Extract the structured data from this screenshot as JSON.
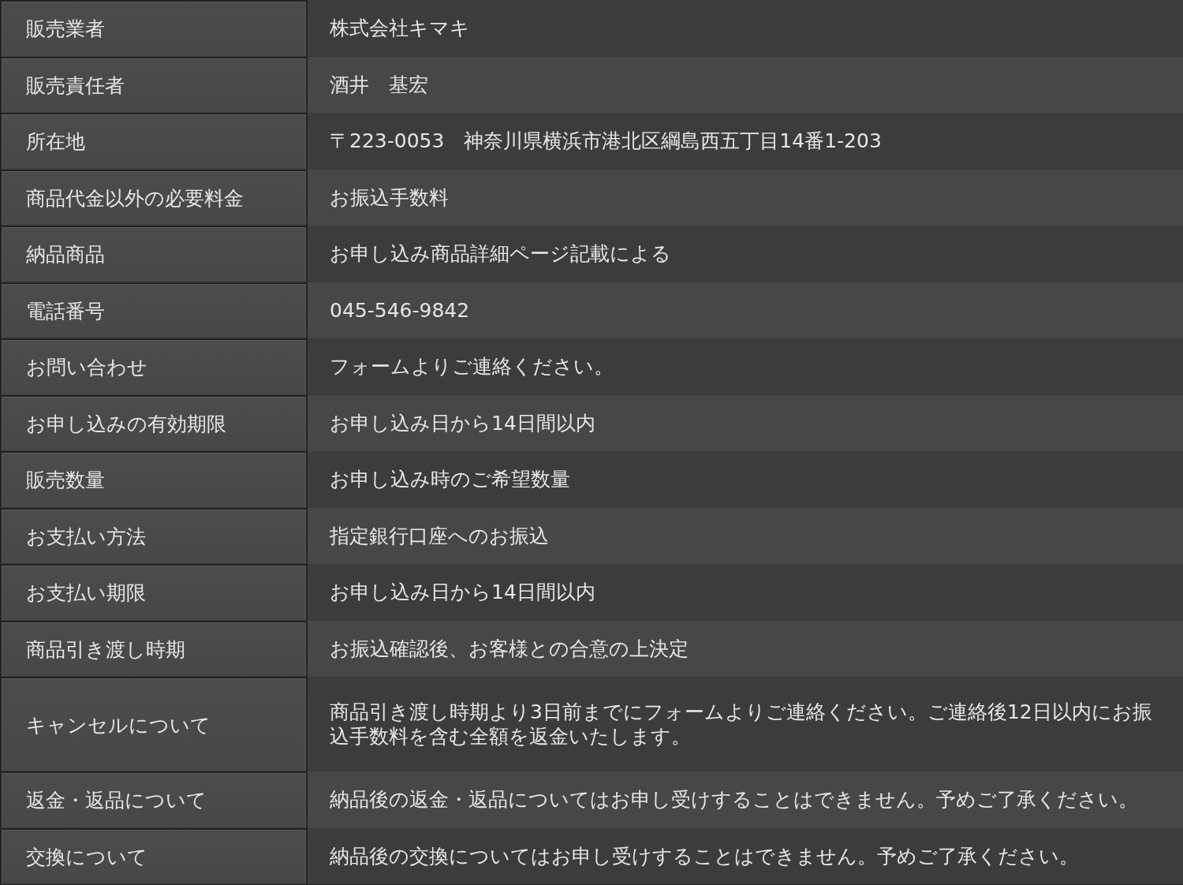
{
  "rows": [
    {
      "label": "販売業者",
      "value": "株式会社キマキ"
    },
    {
      "label": "販売責任者",
      "value": "酒井　基宏"
    },
    {
      "label": "所在地",
      "value": "〒223-0053　神奈川県横浜市港北区綱島西五丁目14番1-203"
    },
    {
      "label": "商品代金以外の必要料金",
      "value": "お振込手数料"
    },
    {
      "label": "納品商品",
      "value": "お申し込み商品詳細ページ記載による"
    },
    {
      "label": "電話番号",
      "value": "045-546-9842"
    },
    {
      "label": "お問い合わせ",
      "value": "フォームよりご連絡ください。"
    },
    {
      "label": "お申し込みの有効期限",
      "value": "お申し込み日から14日間以内"
    },
    {
      "label": "販売数量",
      "value": "お申し込み時のご希望数量"
    },
    {
      "label": "お支払い方法",
      "value": "指定銀行口座へのお振込"
    },
    {
      "label": "お支払い期限",
      "value": "お申し込み日から14日間以内"
    },
    {
      "label": "商品引き渡し時期",
      "value": "お振込確認後、お客様との合意の上決定"
    },
    {
      "label": "キャンセルについて",
      "value": "商品引き渡し時期より3日前までにフォームよりご連絡ください。ご連絡後12日以内にお振込手数料を含む全額を返金いたします。"
    },
    {
      "label": "返金・返品について",
      "value": "納品後の返金・返品についてはお申し受けすることはできません。予めご了承ください。"
    },
    {
      "label": "交換について",
      "value": "納品後の交換についてはお申し受けすることはできません。予めご了承ください。"
    }
  ]
}
